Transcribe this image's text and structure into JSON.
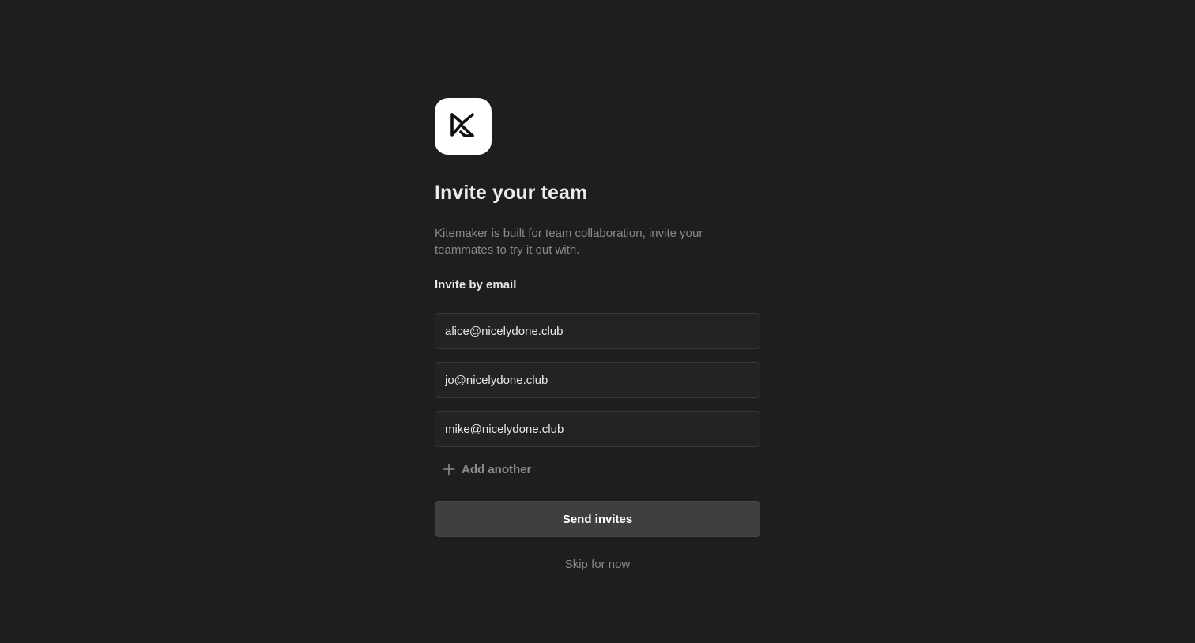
{
  "logo": {
    "icon": "kitemaker-logo-icon",
    "background": "#ffffff"
  },
  "heading": {
    "title": "Invite your team",
    "description": "Kitemaker is built for team collaboration, invite your teammates to try it out with."
  },
  "invite": {
    "section_label": "Invite by email",
    "emails": [
      {
        "value": "alice@nicelydone.club"
      },
      {
        "value": "jo@nicelydone.club"
      },
      {
        "value": "mike@nicelydone.club"
      }
    ],
    "add_another_label": "Add another",
    "add_another_icon": "plus-icon"
  },
  "actions": {
    "send_label": "Send invites",
    "skip_label": "Skip for now"
  },
  "colors": {
    "background": "#1e1e1e",
    "button": "#3f3f3f",
    "field": "#232323"
  }
}
